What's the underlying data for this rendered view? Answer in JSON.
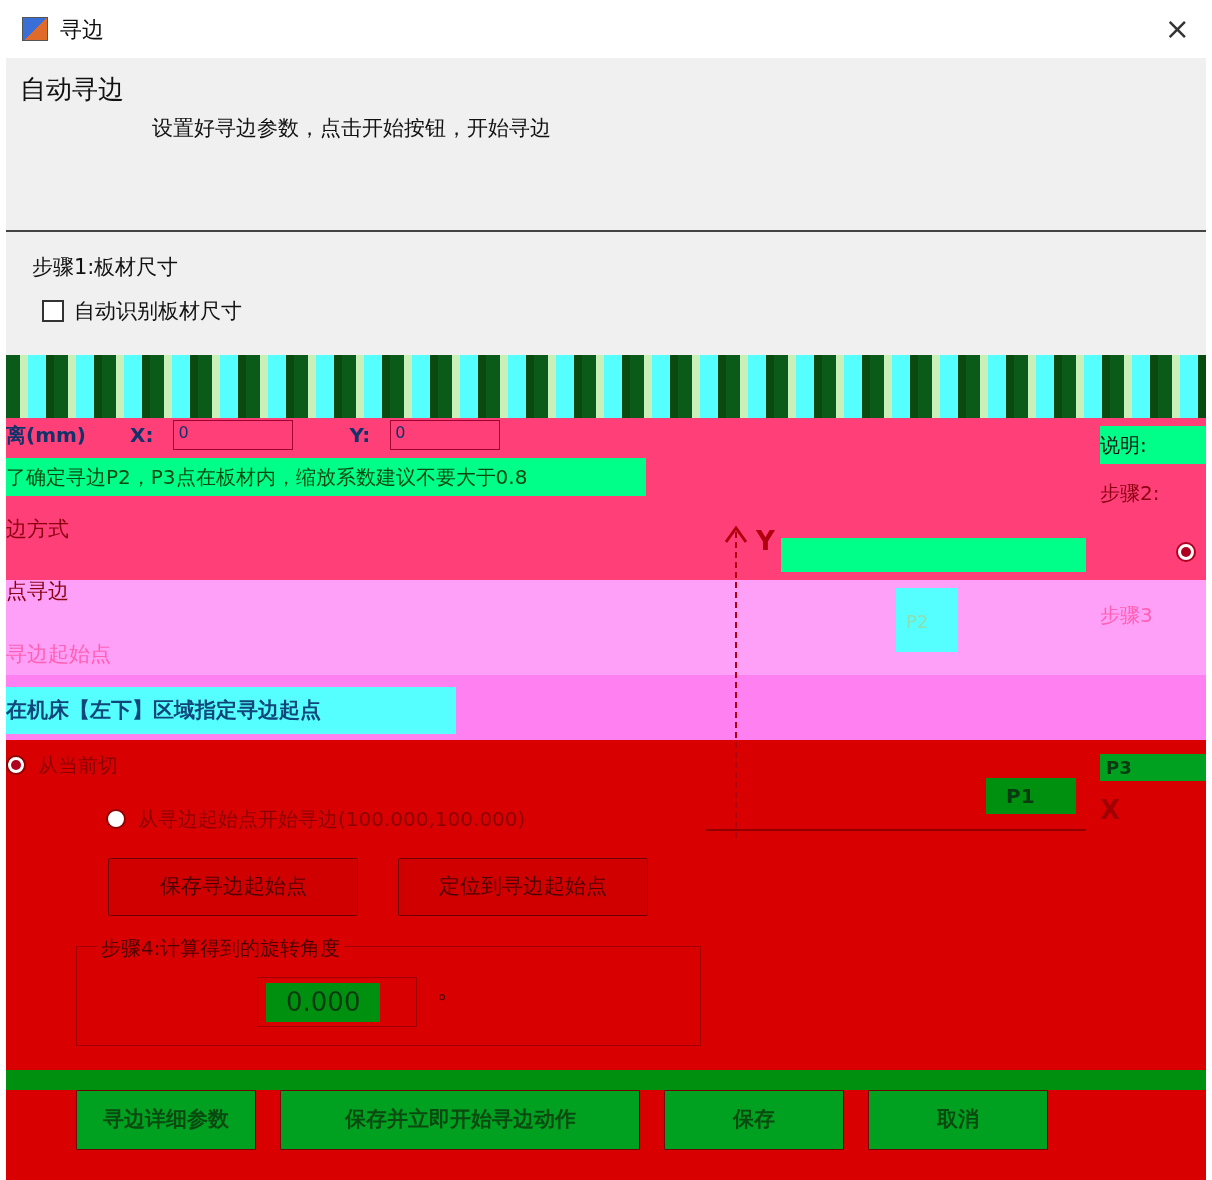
{
  "window": {
    "title": "寻边",
    "close": "×"
  },
  "header": {
    "title": "自动寻边",
    "subtitle": "设置好寻边参数，点击开始按钮，开始寻边"
  },
  "step1": {
    "title": "步骤1:板材尺寸",
    "auto_detect": {
      "label": "自动识别板材尺寸",
      "checked": false
    },
    "offset": {
      "label": "离(mm)",
      "x_label": "X:",
      "x_value": "0",
      "y_label": "Y:",
      "y_value": "0"
    },
    "note": "了确定寻边P2，P3点在板材内，缩放系数建议不要大于0.8"
  },
  "mode": {
    "title": "边方式",
    "option": "点寻边"
  },
  "start": {
    "title": "寻边起始点",
    "instruction": "在机床【左下】区域指定寻边起点",
    "options": [
      {
        "label": "从当前切",
        "selected": true
      },
      {
        "label": "从寻边起始点开始寻边(100.000,100.000)",
        "selected": false
      }
    ],
    "buttons": [
      "保存寻边起始点",
      "定位到寻边起始点"
    ]
  },
  "step4": {
    "title": "步骤4:计算得到的旋转角度",
    "value": "0.000",
    "unit": "°"
  },
  "diagram": {
    "y_axis": "Y",
    "x_axis": "X",
    "points": [
      "P2",
      "P1",
      "P3"
    ]
  },
  "side": {
    "note": "说明:",
    "step2": "步骤2:",
    "radio": {
      "selected": true
    },
    "step3": "步骤3"
  },
  "footer": [
    "寻边详细参数",
    "保存并立即开始寻边动作",
    "保存",
    "取消"
  ]
}
